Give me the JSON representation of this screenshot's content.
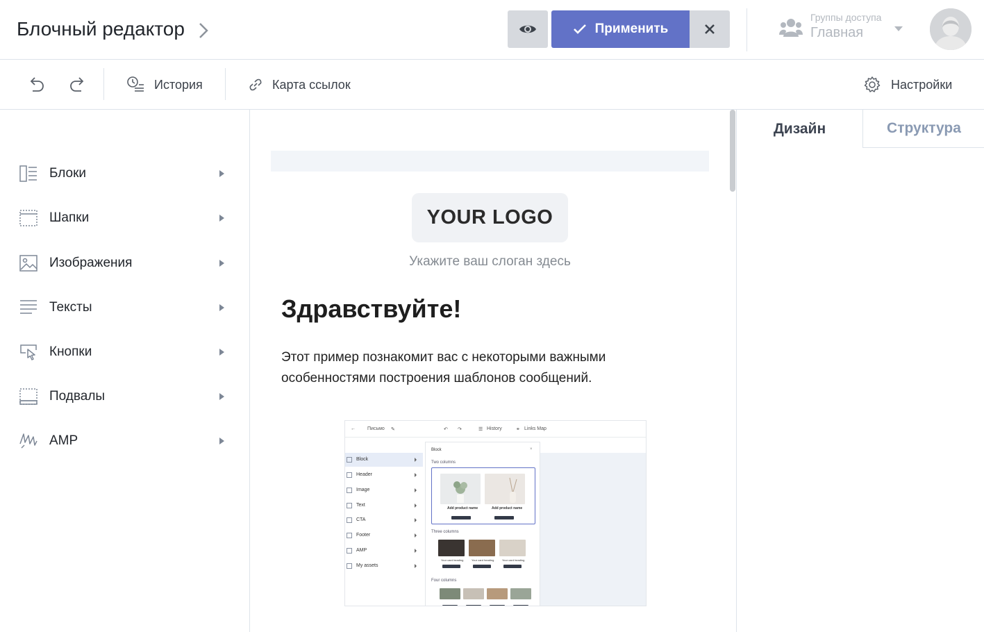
{
  "header": {
    "title": "Блочный редактор",
    "apply_label": "Применить",
    "access_group_label": "Группы доступа",
    "access_group_value": "Главная"
  },
  "toolbar": {
    "history_label": "История",
    "links_map_label": "Карта ссылок",
    "settings_label": "Настройки"
  },
  "sidebar": {
    "items": [
      {
        "label": "Блоки",
        "icon": "blocks-icon"
      },
      {
        "label": "Шапки",
        "icon": "header-icon"
      },
      {
        "label": "Изображения",
        "icon": "image-icon"
      },
      {
        "label": "Тексты",
        "icon": "text-icon"
      },
      {
        "label": "Кнопки",
        "icon": "button-icon"
      },
      {
        "label": "Подвалы",
        "icon": "footer-icon"
      },
      {
        "label": "AMP",
        "icon": "amp-icon"
      }
    ]
  },
  "canvas": {
    "logo_text": "YOUR LOGO",
    "slogan": "Укажите ваш слоган здесь",
    "greeting": "Здравствуйте!",
    "paragraph": "Этот пример познакомит вас с некоторыми важными особенностями построения шаблонов сообщений."
  },
  "mini_screenshot": {
    "doc_name": "Письмо",
    "history_label": "History",
    "links_label": "Links Map",
    "panel_title": "Block",
    "section_two": "Two columns",
    "section_three": "Three columns",
    "section_four": "Four columns",
    "product_name": "Add product name",
    "card_heading": "Your card heading",
    "items": [
      "Block",
      "Header",
      "Image",
      "Text",
      "CTA",
      "Footer",
      "AMP",
      "My assets"
    ]
  },
  "right_panel": {
    "tab_design": "Дизайн",
    "tab_structure": "Структура"
  },
  "colors": {
    "accent": "#6272c7",
    "border": "#dde3ea",
    "muted": "#b3b8bf"
  }
}
